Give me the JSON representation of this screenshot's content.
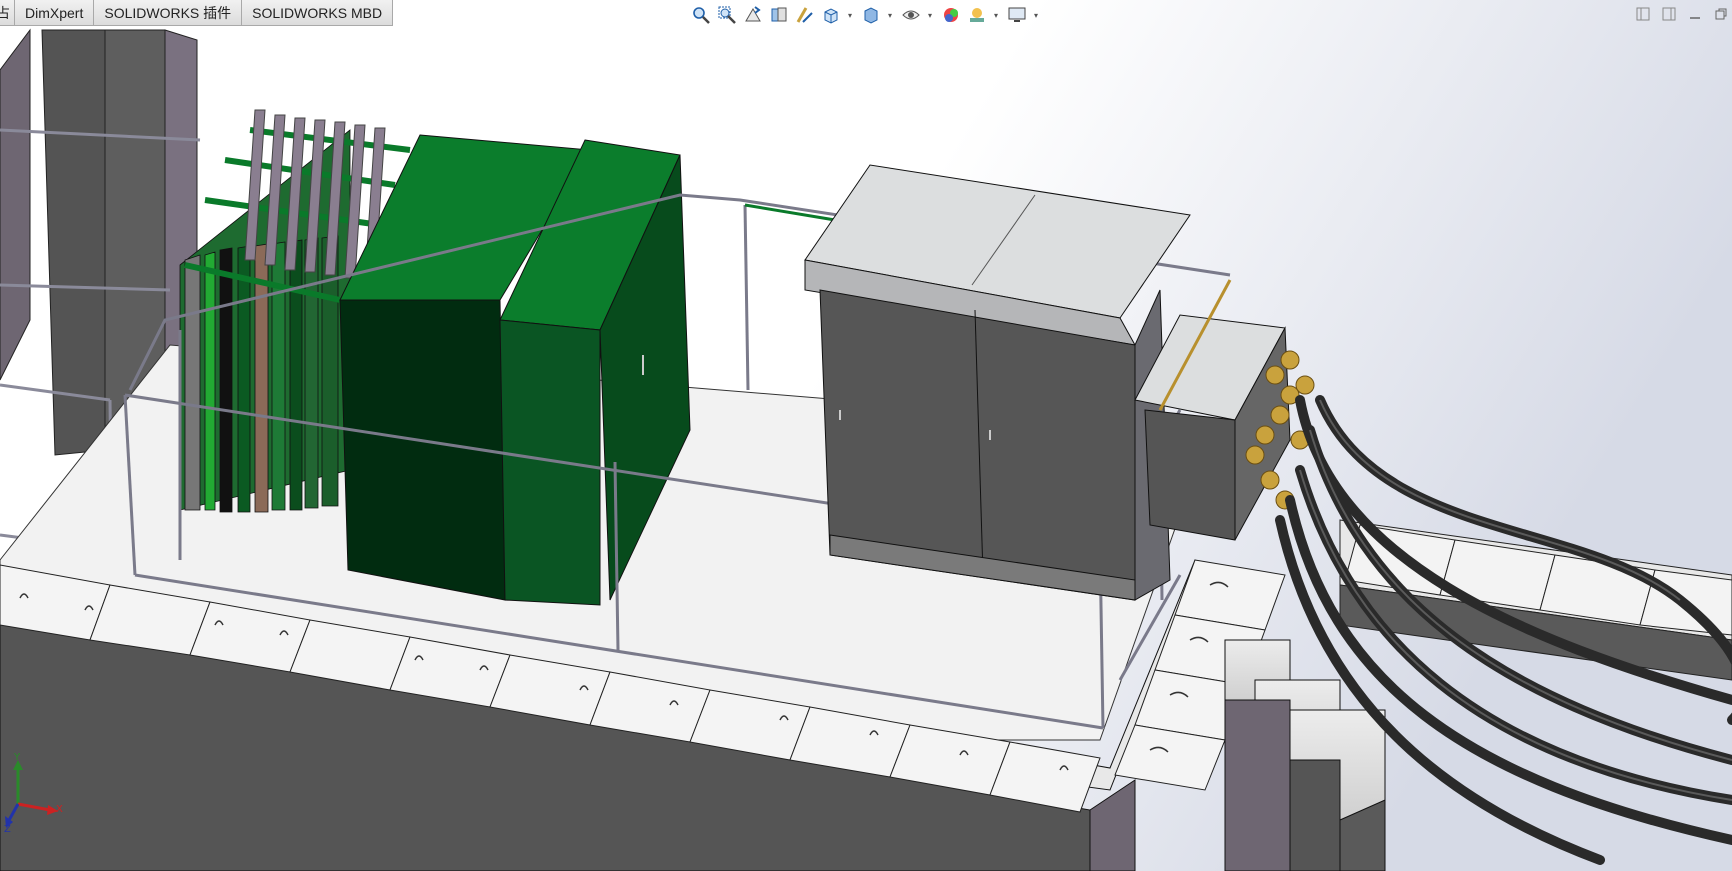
{
  "tabs": [
    {
      "id": "cut",
      "label": "占"
    },
    {
      "id": "dimxpert",
      "label": "DimXpert"
    },
    {
      "id": "sw-addins",
      "label": "SOLIDWORKS 插件"
    },
    {
      "id": "sw-mbd",
      "label": "SOLIDWORKS MBD"
    }
  ],
  "hud": {
    "icons": [
      "zoom-to-fit-icon",
      "zoom-to-area-icon",
      "previous-view-icon",
      "section-view-icon",
      "dynamic-annotation-icon",
      "view-orientation-icon",
      "display-style-icon",
      "hide-show-items-icon",
      "edit-appearance-icon",
      "apply-scene-icon",
      "view-settings-icon"
    ]
  },
  "triad": {
    "x": "X",
    "y": "Y",
    "z": "Z"
  },
  "colors": {
    "background_top": "#ffffff",
    "background_side": "#d8dce8",
    "accent_green": "#0a7a2a",
    "cabinet_grey": "#575757",
    "roof_grey": "#dcdedf",
    "brass": "#b8902e"
  }
}
